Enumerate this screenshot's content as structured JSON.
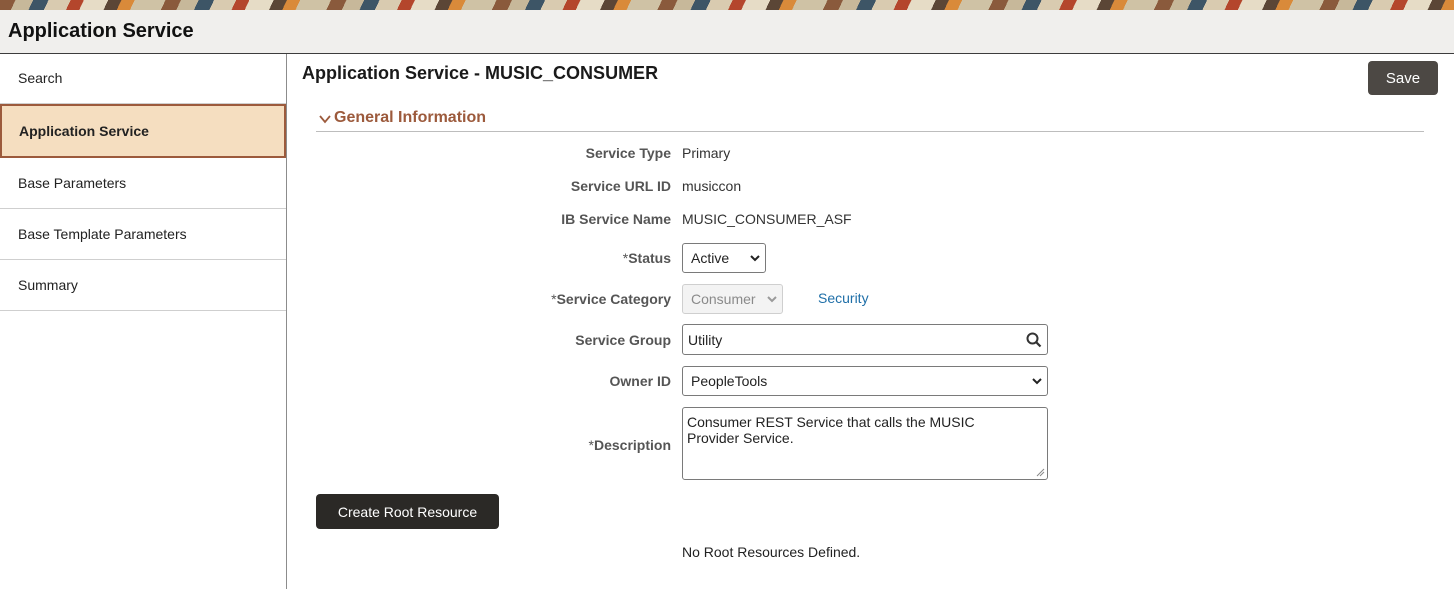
{
  "app": {
    "title": "Application Service"
  },
  "sidebar": {
    "items": [
      {
        "label": "Search"
      },
      {
        "label": "Application Service"
      },
      {
        "label": "Base Parameters"
      },
      {
        "label": "Base Template Parameters"
      },
      {
        "label": "Summary"
      }
    ]
  },
  "main": {
    "page_title": "Application Service - MUSIC_CONSUMER",
    "save_label": "Save",
    "section_label": "General Information",
    "fields": {
      "service_type": {
        "label": "Service Type",
        "value": "Primary"
      },
      "service_url_id": {
        "label": "Service URL ID",
        "value": "musiccon"
      },
      "ib_service_name": {
        "label": "IB Service Name",
        "value": "MUSIC_CONSUMER_ASF"
      },
      "status": {
        "required": "*",
        "label": "Status",
        "value": "Active"
      },
      "service_category": {
        "required": "*",
        "label": "Service Category",
        "value": "Consumer",
        "link": "Security"
      },
      "service_group": {
        "label": "Service Group",
        "value": "Utility"
      },
      "owner_id": {
        "label": "Owner ID",
        "value": "PeopleTools"
      },
      "description": {
        "required": "*",
        "label": "Description",
        "value": "Consumer REST Service that calls the MUSIC Provider Service."
      }
    },
    "create_root_label": "Create Root Resource",
    "empty_message": "No Root Resources Defined."
  },
  "colors": {
    "accent": "#9c5a3c",
    "active_nav_bg": "#f5dec0",
    "button_dark": "#2b2926",
    "save_button": "#4c4844",
    "link": "#1f6fa8"
  },
  "icons": {
    "section_toggle": "chevron-down-icon",
    "search": "search-icon",
    "select_arrow": "chevron-down-icon"
  }
}
